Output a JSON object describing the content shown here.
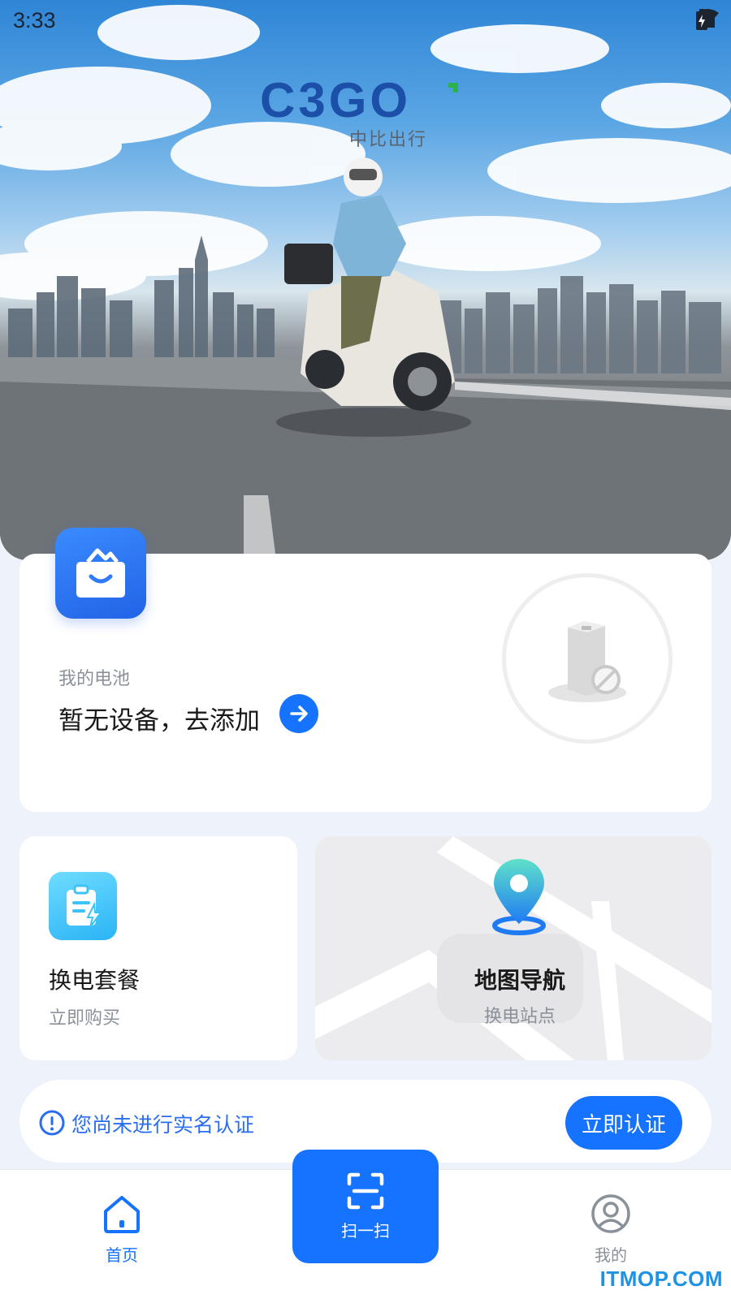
{
  "status_bar": {
    "time": "3:33"
  },
  "brand": {
    "logo": "C3GO",
    "subtitle": "中比出行"
  },
  "battery": {
    "label": "我的电池",
    "status": "暂无设备，去添加"
  },
  "plan_tile": {
    "title": "换电套餐",
    "subtitle": "立即购买"
  },
  "map_tile": {
    "title": "地图导航",
    "subtitle": "换电站点"
  },
  "verify": {
    "message": "您尚未进行实名认证",
    "button": "立即认证"
  },
  "nav": {
    "home": "首页",
    "scan": "扫一扫",
    "me": "我的"
  },
  "watermark": "ITMOP.COM",
  "colors": {
    "primary": "#1673ff",
    "brand_blue": "#1b4fa8",
    "brand_green": "#2bb24c",
    "page_bg": "#eef3fb"
  },
  "icons": [
    "wifi-icon",
    "signal-icon",
    "battery-charging-icon",
    "shopping-bag-icon",
    "arrow-right-icon",
    "clipboard-lightning-icon",
    "location-pin-icon",
    "warning-circle-icon",
    "home-icon",
    "scan-icon",
    "user-icon"
  ]
}
